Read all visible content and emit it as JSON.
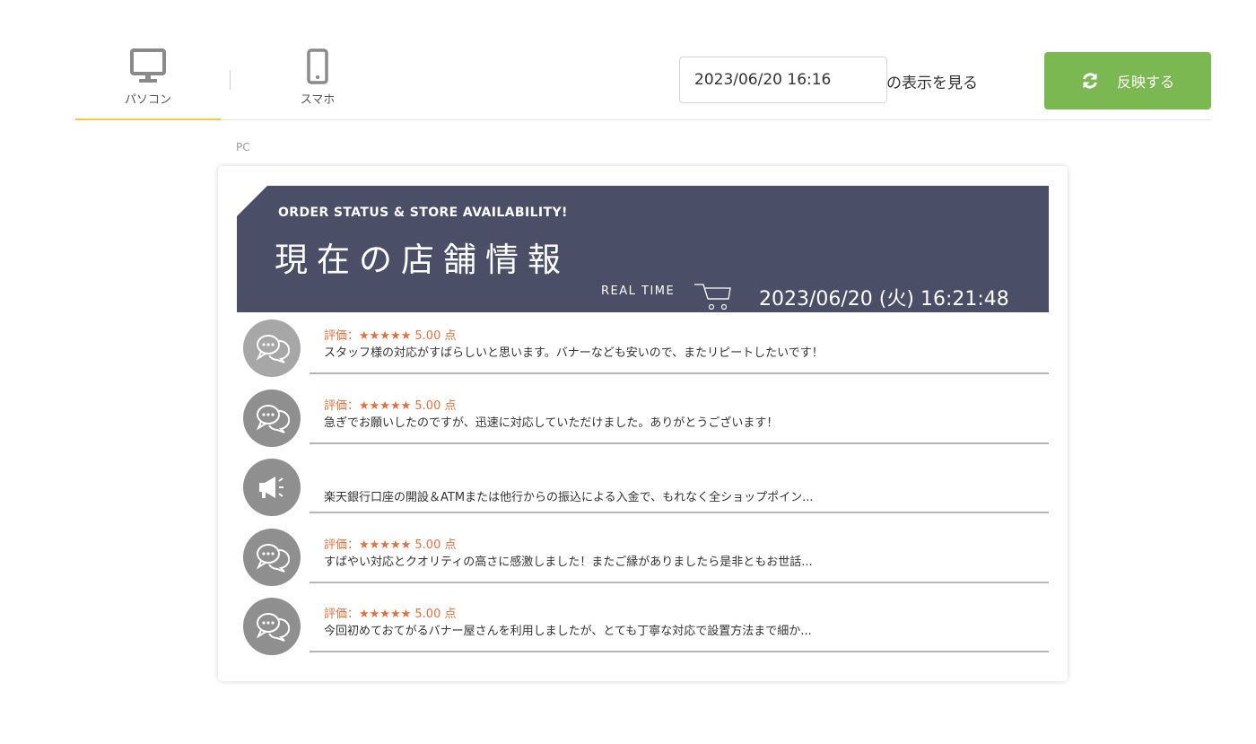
{
  "device_tabs": {
    "pc": {
      "label": "パソコン",
      "icon": "monitor-icon",
      "active": true
    },
    "sp": {
      "label": "スマホ",
      "icon": "smartphone-icon",
      "active": false
    }
  },
  "view_date": {
    "value": "2023/06/20 16:16",
    "suffix": "の表示を見る"
  },
  "reflect_button": {
    "label": "反映する",
    "icon": "refresh-icon"
  },
  "preview": {
    "section_label": "PC",
    "banner": {
      "title_en": "ORDER STATUS & STORE AVAILABILITY!",
      "title_jp": "現在の店舗情報",
      "realtime_label": "REAL TIME",
      "datetime": "2023/06/20 (火) 16:21:48",
      "background_color": "#4b4e67"
    },
    "items": [
      {
        "type": "review",
        "icon": "chat-bubble-icon",
        "rating": "評価：★★★★★ 5.00 点",
        "text": "スタッフ様の対応がすばらしいと思います。バナーなども安いので、またリピートしたいです！"
      },
      {
        "type": "review",
        "icon": "chat-bubble-icon",
        "rating": "評価：★★★★★ 5.00 点",
        "text": "急ぎでお願いしたのですが、迅速に対応していただけました。ありがとうございます！"
      },
      {
        "type": "notice",
        "icon": "megaphone-icon",
        "rating": "",
        "text": "楽天銀行口座の開設＆ATMまたは他行からの振込による入金で、もれなく全ショップポイン..."
      },
      {
        "type": "review",
        "icon": "chat-bubble-icon",
        "rating": "評価：★★★★★ 5.00 点",
        "text": "すばやい対応とクオリティの高さに感激しました！またご縁がありましたら是非ともお世話..."
      },
      {
        "type": "review",
        "icon": "chat-bubble-icon",
        "rating": "評価：★★★★★ 5.00 点",
        "text": "今回初めておてがるバナー屋さんを利用しましたが、とても丁寧な対応で設置方法まで細か..."
      }
    ]
  },
  "colors": {
    "accent_tab_underline": "#f1c74a",
    "reflect_button": "#7bb852",
    "rating_text": "#e0713e"
  }
}
